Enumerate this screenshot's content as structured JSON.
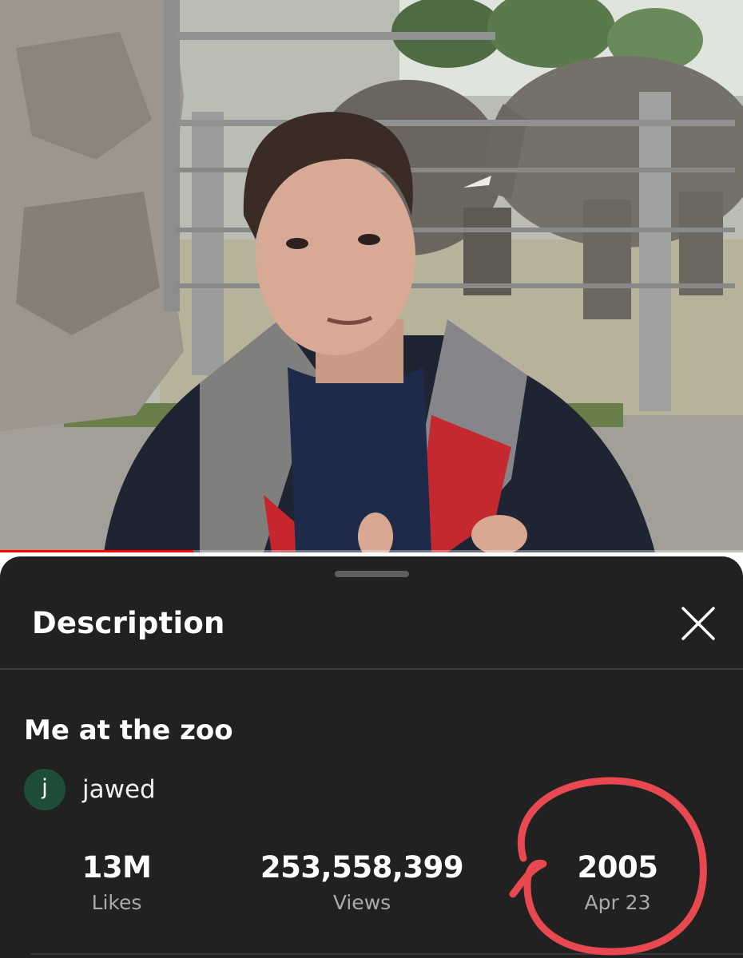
{
  "sheet": {
    "title": "Description"
  },
  "video": {
    "title": "Me at the zoo",
    "progress_fraction": 0.26
  },
  "channel": {
    "avatar_letter": "j",
    "name": "jawed"
  },
  "stats": [
    {
      "value": "13M",
      "label": "Likes"
    },
    {
      "value": "253,558,399",
      "label": "Views"
    },
    {
      "value": "2005",
      "label": "Apr 23"
    }
  ],
  "colors": {
    "sheet_background": "#212121",
    "progress": "#ff0000",
    "avatar": "#1e4d3a",
    "annotation_circle": "#e8484f"
  },
  "icons": {
    "close": "close-icon"
  }
}
